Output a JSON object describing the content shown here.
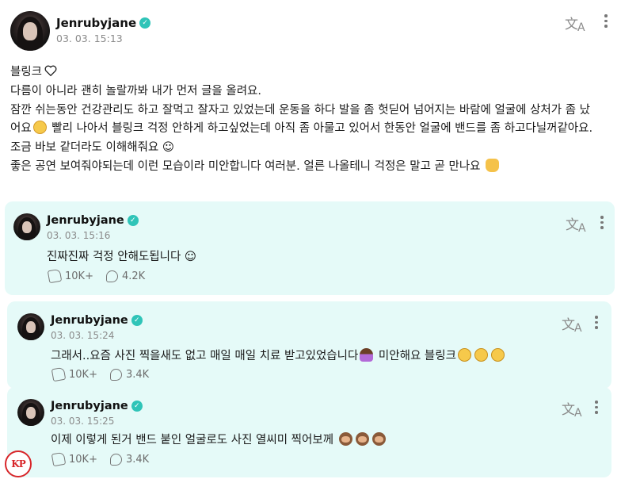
{
  "main_post": {
    "author": "Jenrubyjane",
    "timestamp": "03. 03. 15:13",
    "lines": [
      "블링크",
      "다름이 아니라 괜히 놀랄까봐 내가 먼저 글을 올려요.",
      "잠깐 쉬는동안 건강관리도 하고 잘먹고 잘자고 있었는데 운동을 하다 발을 좀 헛딛어 넘어지는 바람에 얼굴에 상처가 좀 났",
      "어요",
      " 빨리 나아서 블링크 걱정 안하게 하고싶었는데 아직 좀 아물고 있어서 한동안 얼굴에 밴드를 좀 하고다닐꺼같아요.",
      "조금 바보 같더라도 이해해줘요 ☺",
      "좋은 공연 보여줘야되는데 이런 모습이라 미안합니다 여러분. 얼른 나올테니 걱정은 말고 곧 만나요"
    ]
  },
  "replies": [
    {
      "author": "Jenrubyjane",
      "timestamp": "03. 03. 15:16",
      "text": "진짜진짜 걱정 안해도됩니다 ☺",
      "likes": "10K+",
      "comments": "4.2K"
    },
    {
      "author": "Jenrubyjane",
      "timestamp": "03. 03. 15:24",
      "text": "그래서..요즘 사진 찍을새도 없고 매일 매일 치료 받고있었습니다",
      "text_suffix": " 미안해요 블링크",
      "likes": "10K+",
      "comments": "3.4K"
    },
    {
      "author": "Jenrubyjane",
      "timestamp": "03. 03. 15:25",
      "text": "이제 이렇게 된거 밴드 붙인 얼굴로도 사진 열씨미 찍어보께",
      "likes": "10K+",
      "comments": "3.4K"
    }
  ],
  "icons": {
    "translate": "translate-icon",
    "more": "more-vertical-icon",
    "verified": "verified-badge-icon",
    "like": "like-icon",
    "comment": "comment-icon"
  },
  "colors": {
    "reply_bg": "#e5faf8",
    "verified": "#2fc4b8",
    "watermark": "#d8262a"
  },
  "watermark": "KP"
}
